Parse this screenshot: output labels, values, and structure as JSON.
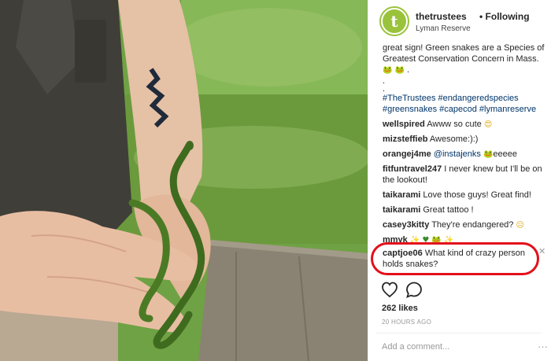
{
  "header": {
    "username": "thetrustees",
    "following_label": "• Following",
    "location": "Lyman Reserve",
    "avatar_letter": "t",
    "brand_color": "#9ac33c"
  },
  "caption": {
    "text": "great sign! Green snakes are a Species of Greatest Conservation Concern in Mass.",
    "dot1": ".",
    "dot2": ".",
    "hashtags": "#TheTrustees #endangeredspecies #greensnakes #capecod #lymanreserve"
  },
  "comments": [
    {
      "user": "wellspired",
      "text": "Awww so cute"
    },
    {
      "user": "mizsteffieb",
      "text": "Awesome:):)"
    },
    {
      "user": "orangej4me",
      "mention": "@instajenks",
      "text": "eeeee"
    },
    {
      "user": "fitfuntravel247",
      "text": "I never knew but I'll be on the lookout!"
    },
    {
      "user": "taikarami",
      "text": "Love those guys! Great find!"
    },
    {
      "user": "taikarami",
      "text": "Great tattoo !"
    },
    {
      "user": "casey3kitty",
      "text": "They're endangered?"
    },
    {
      "user": "mmyk",
      "text": ""
    },
    {
      "user": "captjoe06",
      "text": "What kind of crazy person holds snakes?"
    }
  ],
  "icons": {
    "frog": "frog-emoji",
    "heart_eyes": "heart-eyes-emoji",
    "sad": "sad-emoji",
    "sparkles": "sparkles-emoji",
    "green_heart": "green-heart-emoji"
  },
  "close_glyph": "✕",
  "highlight_color": "#e3101b",
  "likes": "262 likes",
  "time": "20 HOURS AGO",
  "add_comment_placeholder": "Add a comment...",
  "more_glyph": "···"
}
